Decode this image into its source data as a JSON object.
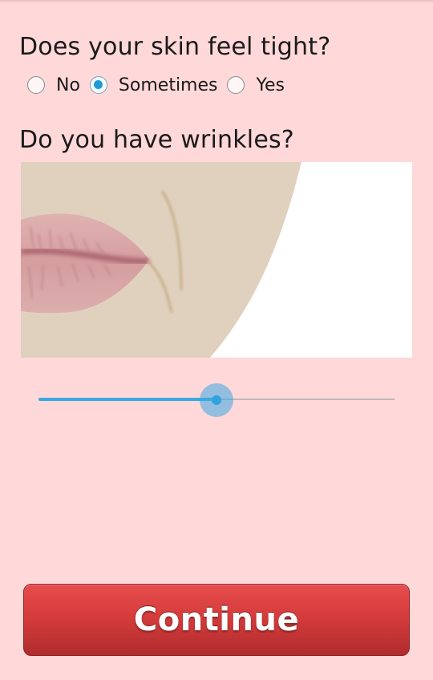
{
  "questions": {
    "skin_tight": {
      "label": "Does your skin feel tight?",
      "options": [
        "No",
        "Sometimes",
        "Yes"
      ],
      "selected": "Sometimes"
    },
    "wrinkles": {
      "label": "Do you have wrinkles?",
      "slider_value_fraction": 0.5
    }
  },
  "continue_button": {
    "label": "Continue"
  },
  "colors": {
    "background": "#ffd8d9",
    "accent": "#1e9ad6",
    "button": "#d63c3c",
    "skin": "#e0d1bf",
    "lips": "#d9a3a3"
  }
}
